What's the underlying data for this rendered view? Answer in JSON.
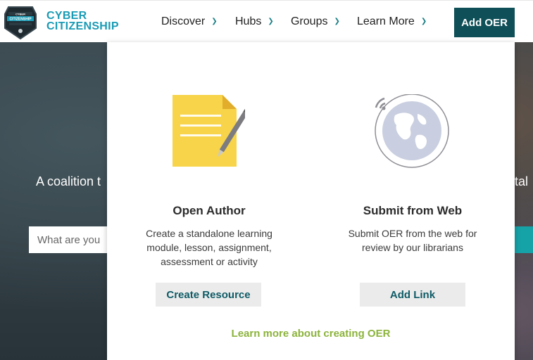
{
  "brand": {
    "line1": "CYBER",
    "line2": "CITIZENSHIP",
    "badge_text": "CYBER CITIZENSHIP"
  },
  "nav": [
    {
      "label": "Discover"
    },
    {
      "label": "Hubs"
    },
    {
      "label": "Groups"
    },
    {
      "label": "Learn More"
    }
  ],
  "add_oer_label": "Add OER",
  "hero": {
    "tagline_left": "A coalition t",
    "tagline_right": "tal",
    "search_placeholder": "What are you"
  },
  "menu": {
    "open_author": {
      "title": "Open Author",
      "desc": [
        "Create a standalone learning",
        "module, lesson, assignment,",
        "assessment or activity"
      ],
      "button": "Create Resource",
      "icon": "document-pencil-icon"
    },
    "submit_web": {
      "title": "Submit from Web",
      "desc": [
        "Submit OER from the web for",
        "review by our librarians"
      ],
      "button": "Add Link",
      "icon": "globe-icon"
    },
    "learn_more_link": "Learn more about creating OER"
  },
  "colors": {
    "brand_teal": "#1a9bb5",
    "button_dark": "#0e4f58",
    "link_green": "#8cb33c"
  }
}
